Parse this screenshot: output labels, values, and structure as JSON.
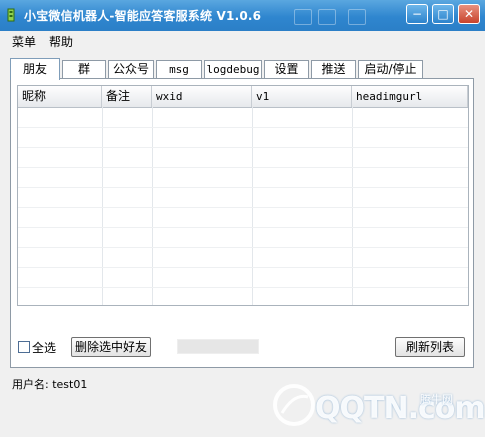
{
  "window": {
    "title": "小宝微信机器人-智能应答客服系统 V1.0.6",
    "minimize_glyph": "−",
    "maximize_glyph": "□",
    "close_glyph": "✕"
  },
  "menu": [
    "菜单",
    "帮助"
  ],
  "tabs": [
    "朋友",
    "群",
    "公众号",
    "msg",
    "logdebug",
    "设置",
    "推送",
    "启动/停止"
  ],
  "active_tab": "朋友",
  "table": {
    "columns": [
      "昵称",
      "备注",
      "wxid",
      "v1",
      "headimgurl"
    ],
    "rows": []
  },
  "controls": {
    "select_all_label": "全选",
    "delete_button": "删除选中好友",
    "refresh_button": "刷新列表"
  },
  "status_bar": {
    "username_text": "用户名: test01"
  },
  "watermark": {
    "logo_text": "QQTN.com",
    "badge_text": "腾牛网"
  },
  "colors": {
    "titlebar": "#2f86cf",
    "close_button": "#c7432d",
    "window_background": "#f0f0f0"
  }
}
